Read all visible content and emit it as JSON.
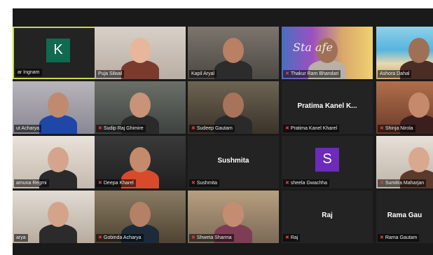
{
  "window": {
    "title": ""
  },
  "colors": {
    "active_border": "#c8d94a",
    "mic_muted": "#e0393e",
    "avatar_green": "#0f6a4f",
    "avatar_purple": "#6c2bb8"
  },
  "tiles": [
    {
      "label": "ar Ingnam",
      "avatar": "K",
      "avatar_color": "#0f6a4f",
      "muted": false,
      "active": true
    },
    {
      "label": "Puja Silwal",
      "muted": false
    },
    {
      "label": "Kapil Aryal",
      "muted": false
    },
    {
      "label": "Thakur Ram Bhandari",
      "muted": true,
      "watermark": "Sta   afe"
    },
    {
      "label": "Ashora Dahal",
      "muted": false
    },
    {
      "label": "ut Acharya",
      "muted": false
    },
    {
      "label": "Sudip Raj Ghimire",
      "muted": true
    },
    {
      "label": "Sudeep Gautam",
      "muted": true
    },
    {
      "label": "Pratima Kanel Kharel",
      "muted": true,
      "center_name": "Pratima Kanel K..."
    },
    {
      "label": "Shinja Nirola",
      "muted": true
    },
    {
      "label": "amuna Regmi",
      "muted": false
    },
    {
      "label": "Deepa Kharel",
      "muted": true
    },
    {
      "label": "Sushmita",
      "muted": true,
      "center_name": "Sushmita"
    },
    {
      "label": "sheela Gwachha",
      "muted": true,
      "avatar": "S",
      "avatar_color": "#6c2bb8"
    },
    {
      "label": "Sumitra Maharjan",
      "muted": true
    },
    {
      "label": "arya",
      "muted": false
    },
    {
      "label": "Gobinda Acharya",
      "muted": true
    },
    {
      "label": "Shweta Sharma",
      "muted": true
    },
    {
      "label": "Raj",
      "muted": true,
      "center_name": "Raj"
    },
    {
      "label": "Rama Gautam",
      "muted": true,
      "center_name": "Rama Gau"
    }
  ]
}
